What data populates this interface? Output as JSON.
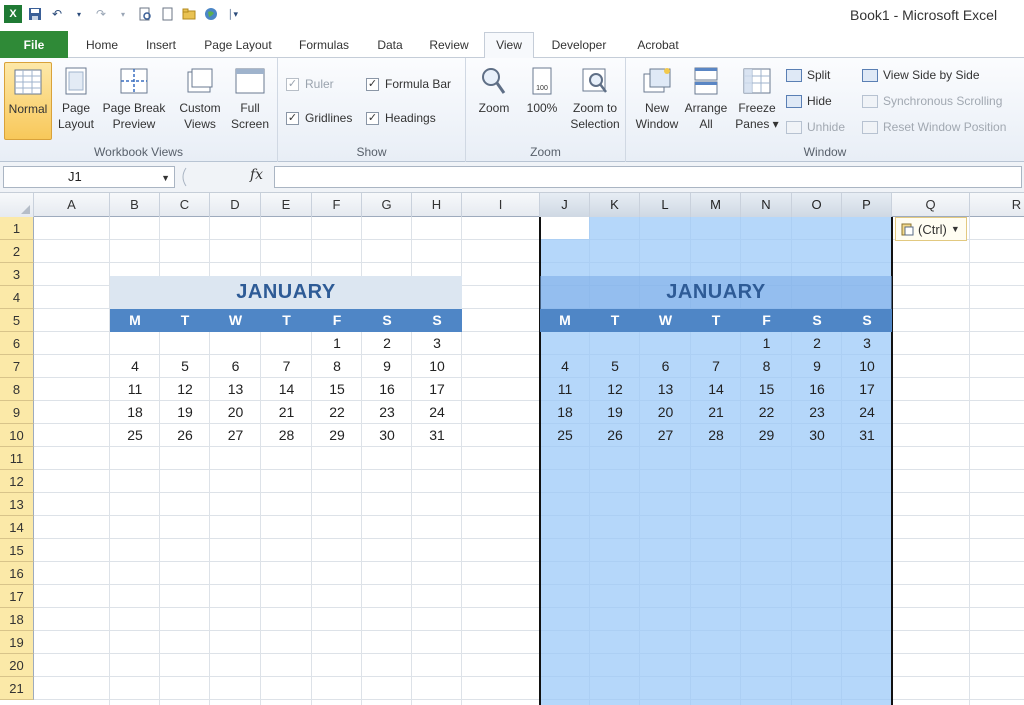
{
  "window": {
    "title": "Book1  -  Microsoft Excel"
  },
  "qat": {
    "items": [
      "excel-icon",
      "save-icon",
      "undo-icon",
      "redo-icon",
      "print-preview-icon",
      "new-icon",
      "open-icon",
      "web-icon",
      "customize-icon"
    ]
  },
  "tabs": [
    {
      "label": "File"
    },
    {
      "label": "Home"
    },
    {
      "label": "Insert"
    },
    {
      "label": "Page Layout"
    },
    {
      "label": "Formulas"
    },
    {
      "label": "Data"
    },
    {
      "label": "Review"
    },
    {
      "label": "View"
    },
    {
      "label": "Developer"
    },
    {
      "label": "Acrobat"
    }
  ],
  "ribbon": {
    "workbook_views": {
      "label": "Workbook Views",
      "normal": "Normal",
      "page_layout_1": "Page",
      "page_layout_2": "Layout",
      "page_break_1": "Page Break",
      "page_break_2": "Preview",
      "custom_1": "Custom",
      "custom_2": "Views",
      "full_1": "Full",
      "full_2": "Screen"
    },
    "show": {
      "label": "Show",
      "ruler": "Ruler",
      "formula_bar": "Formula Bar",
      "gridlines": "Gridlines",
      "headings": "Headings"
    },
    "zoom": {
      "label": "Zoom",
      "zoom": "Zoom",
      "hundred": "100%",
      "to_sel_1": "Zoom to",
      "to_sel_2": "Selection"
    },
    "window": {
      "label": "Window",
      "new_1": "New",
      "new_2": "Window",
      "arrange_1": "Arrange",
      "arrange_2": "All",
      "freeze_1": "Freeze",
      "freeze_2": "Panes ▾",
      "split": "Split",
      "hide": "Hide",
      "unhide": "Unhide",
      "side_by_side": "View Side by Side",
      "sync_scroll": "Synchronous Scrolling",
      "reset_pos": "Reset Window Position"
    }
  },
  "formula_bar": {
    "name_box": "J1",
    "fx": "fx",
    "value": ""
  },
  "columns": [
    "A",
    "B",
    "C",
    "D",
    "E",
    "F",
    "G",
    "H",
    "I",
    "J",
    "K",
    "L",
    "M",
    "N",
    "O",
    "P",
    "Q",
    "R"
  ],
  "rows": [
    "1",
    "2",
    "3",
    "4",
    "5",
    "6",
    "7",
    "8",
    "9",
    "10",
    "11",
    "12",
    "13",
    "14",
    "15",
    "16",
    "17",
    "18",
    "19",
    "20",
    "21"
  ],
  "calendar": {
    "month": "JANUARY",
    "days": [
      "M",
      "T",
      "W",
      "T",
      "F",
      "S",
      "S"
    ],
    "weeks": [
      [
        "",
        "",
        "",
        "",
        "1",
        "2",
        "3"
      ],
      [
        "4",
        "5",
        "6",
        "7",
        "8",
        "9",
        "10"
      ],
      [
        "11",
        "12",
        "13",
        "14",
        "15",
        "16",
        "17"
      ],
      [
        "18",
        "19",
        "20",
        "21",
        "22",
        "23",
        "24"
      ],
      [
        "25",
        "26",
        "27",
        "28",
        "29",
        "30",
        "31"
      ]
    ]
  },
  "paste_options": {
    "label": "(Ctrl)"
  },
  "colors": {
    "accent": "#4f86c6",
    "month_band": "#dce6f1",
    "selection": "#99c8f8",
    "file_tab": "#2f8a37"
  }
}
